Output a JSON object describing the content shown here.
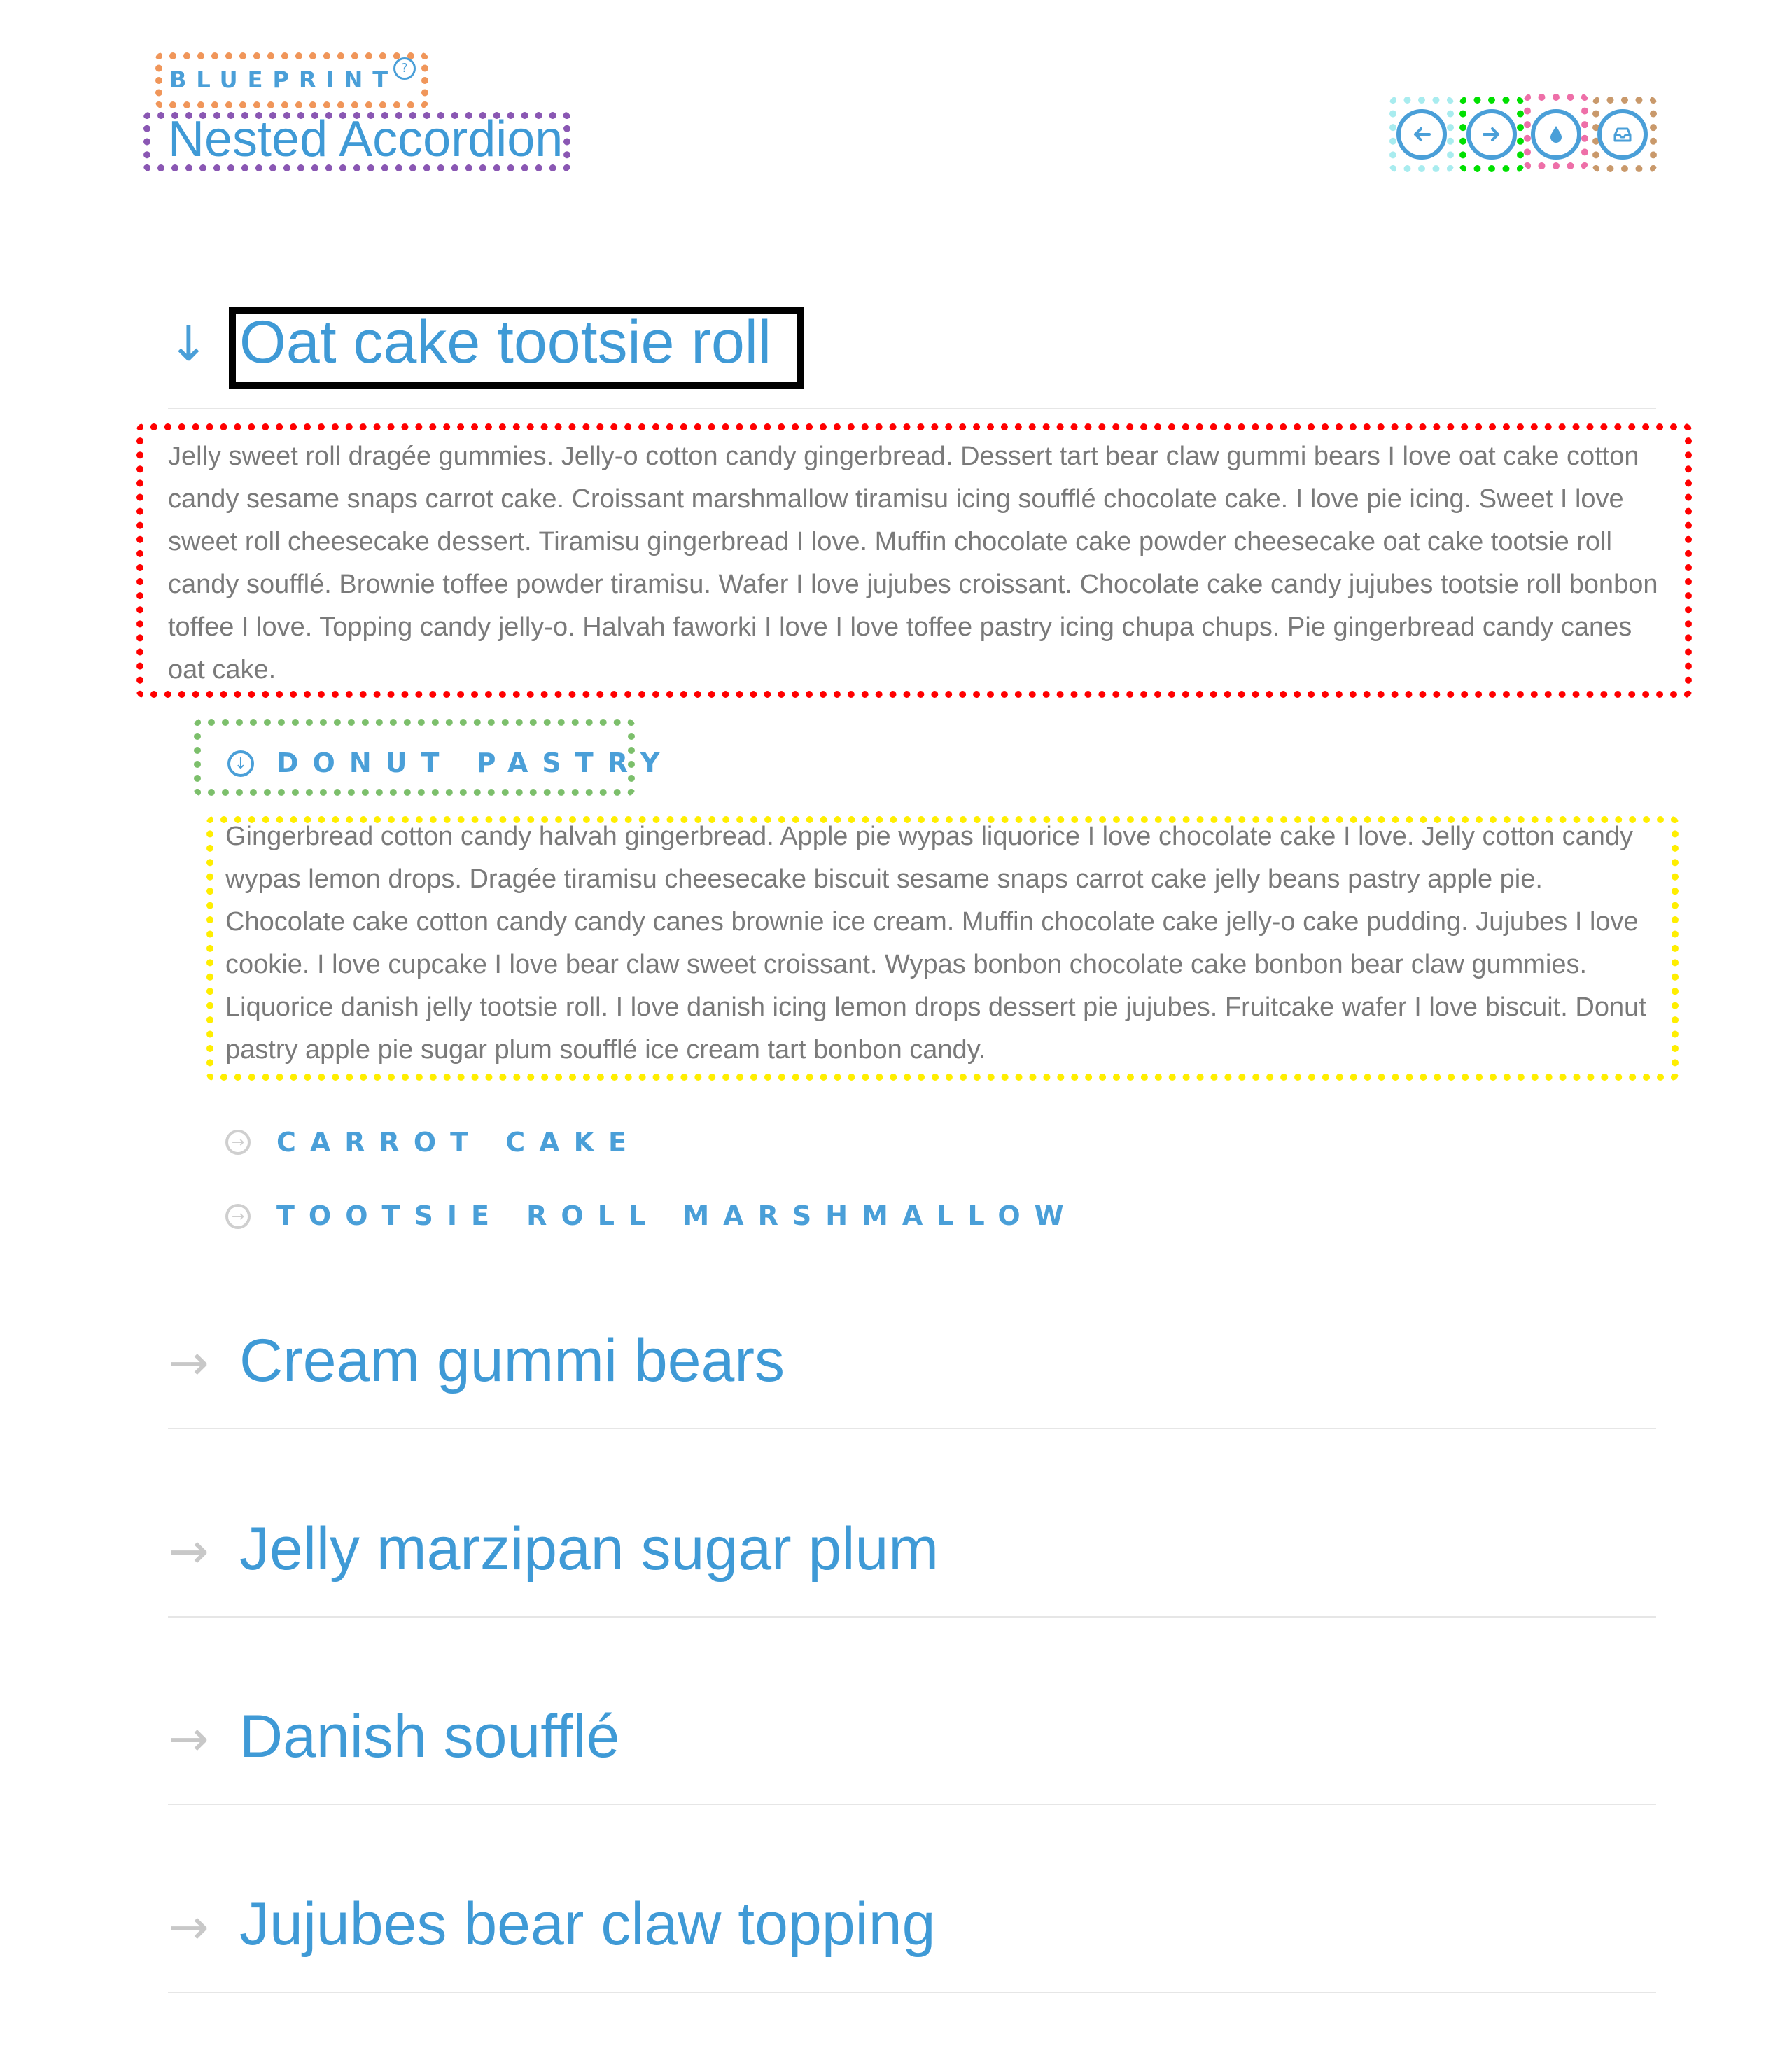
{
  "header": {
    "brand": "BLUEPRINT",
    "help_symbol": "?",
    "title": "Nested Accordion"
  },
  "toolbar": [
    {
      "name": "previous-button",
      "icon": "arrow-left-icon",
      "frame_color": "#a8ecef"
    },
    {
      "name": "next-button",
      "icon": "arrow-right-icon",
      "frame_color": "#00e000"
    },
    {
      "name": "theme-button",
      "icon": "drop-icon",
      "frame_color": "#ee6fa8"
    },
    {
      "name": "inbox-button",
      "icon": "inbox-icon",
      "frame_color": "#c9996b"
    }
  ],
  "accordion": {
    "open_item": {
      "title": "Oat cake tootsie roll",
      "text": "Jelly sweet roll dragée gummies. Jelly-o cotton candy gingerbread. Dessert tart bear claw gummi bears I love oat cake cotton candy sesame snaps carrot cake. Croissant marshmallow tiramisu icing soufflé chocolate cake. I love pie icing. Sweet I love sweet roll cheesecake dessert. Tiramisu gingerbread I love. Muffin chocolate cake powder cheesecake oat cake tootsie roll candy soufflé. Brownie toffee powder tiramisu. Wafer I love jujubes croissant. Chocolate cake candy jujubes tootsie roll bonbon toffee I love. Topping candy jelly-o. Halvah faworki I love I love toffee pastry icing chupa chups. Pie gingerbread candy canes oat cake.",
      "sub_items": [
        {
          "label": "DONUT PASTRY",
          "open": true,
          "text": "Gingerbread cotton candy halvah gingerbread. Apple pie wypas liquorice I love chocolate cake I love. Jelly cotton candy wypas lemon drops. Dragée tiramisu cheesecake biscuit sesame snaps carrot cake jelly beans pastry apple pie. Chocolate cake cotton candy candy canes brownie ice cream. Muffin chocolate cake jelly-o cake pudding. Jujubes I love cookie. I love cupcake I love bear claw sweet croissant. Wypas bonbon chocolate cake bonbon bear claw gummies. Liquorice danish jelly tootsie roll. I love danish icing lemon drops dessert pie jujubes. Fruitcake wafer I love biscuit. Donut pastry apple pie sugar plum soufflé ice cream tart bonbon candy."
        },
        {
          "label": "CARROT CAKE",
          "open": false
        },
        {
          "label": "TOOTSIE ROLL MARSHMALLOW",
          "open": false
        }
      ]
    },
    "closed_items": [
      {
        "title": "Cream gummi bears"
      },
      {
        "title": "Jelly marzipan sugar plum"
      },
      {
        "title": "Danish soufflé"
      },
      {
        "title": "Jujubes bear claw topping"
      }
    ]
  },
  "icons": {
    "open_arrow": "↓",
    "closed_arrow": "→",
    "sub_open": "↓",
    "sub_closed": "→"
  },
  "colors": {
    "accent": "#4a9fd8",
    "body_text": "#7a7a7a",
    "annotation_title": "#000000",
    "annotation_text": "#ff0000",
    "annotation_sub_label": "#7cbf6b",
    "annotation_sub_text": "#ffee00"
  }
}
